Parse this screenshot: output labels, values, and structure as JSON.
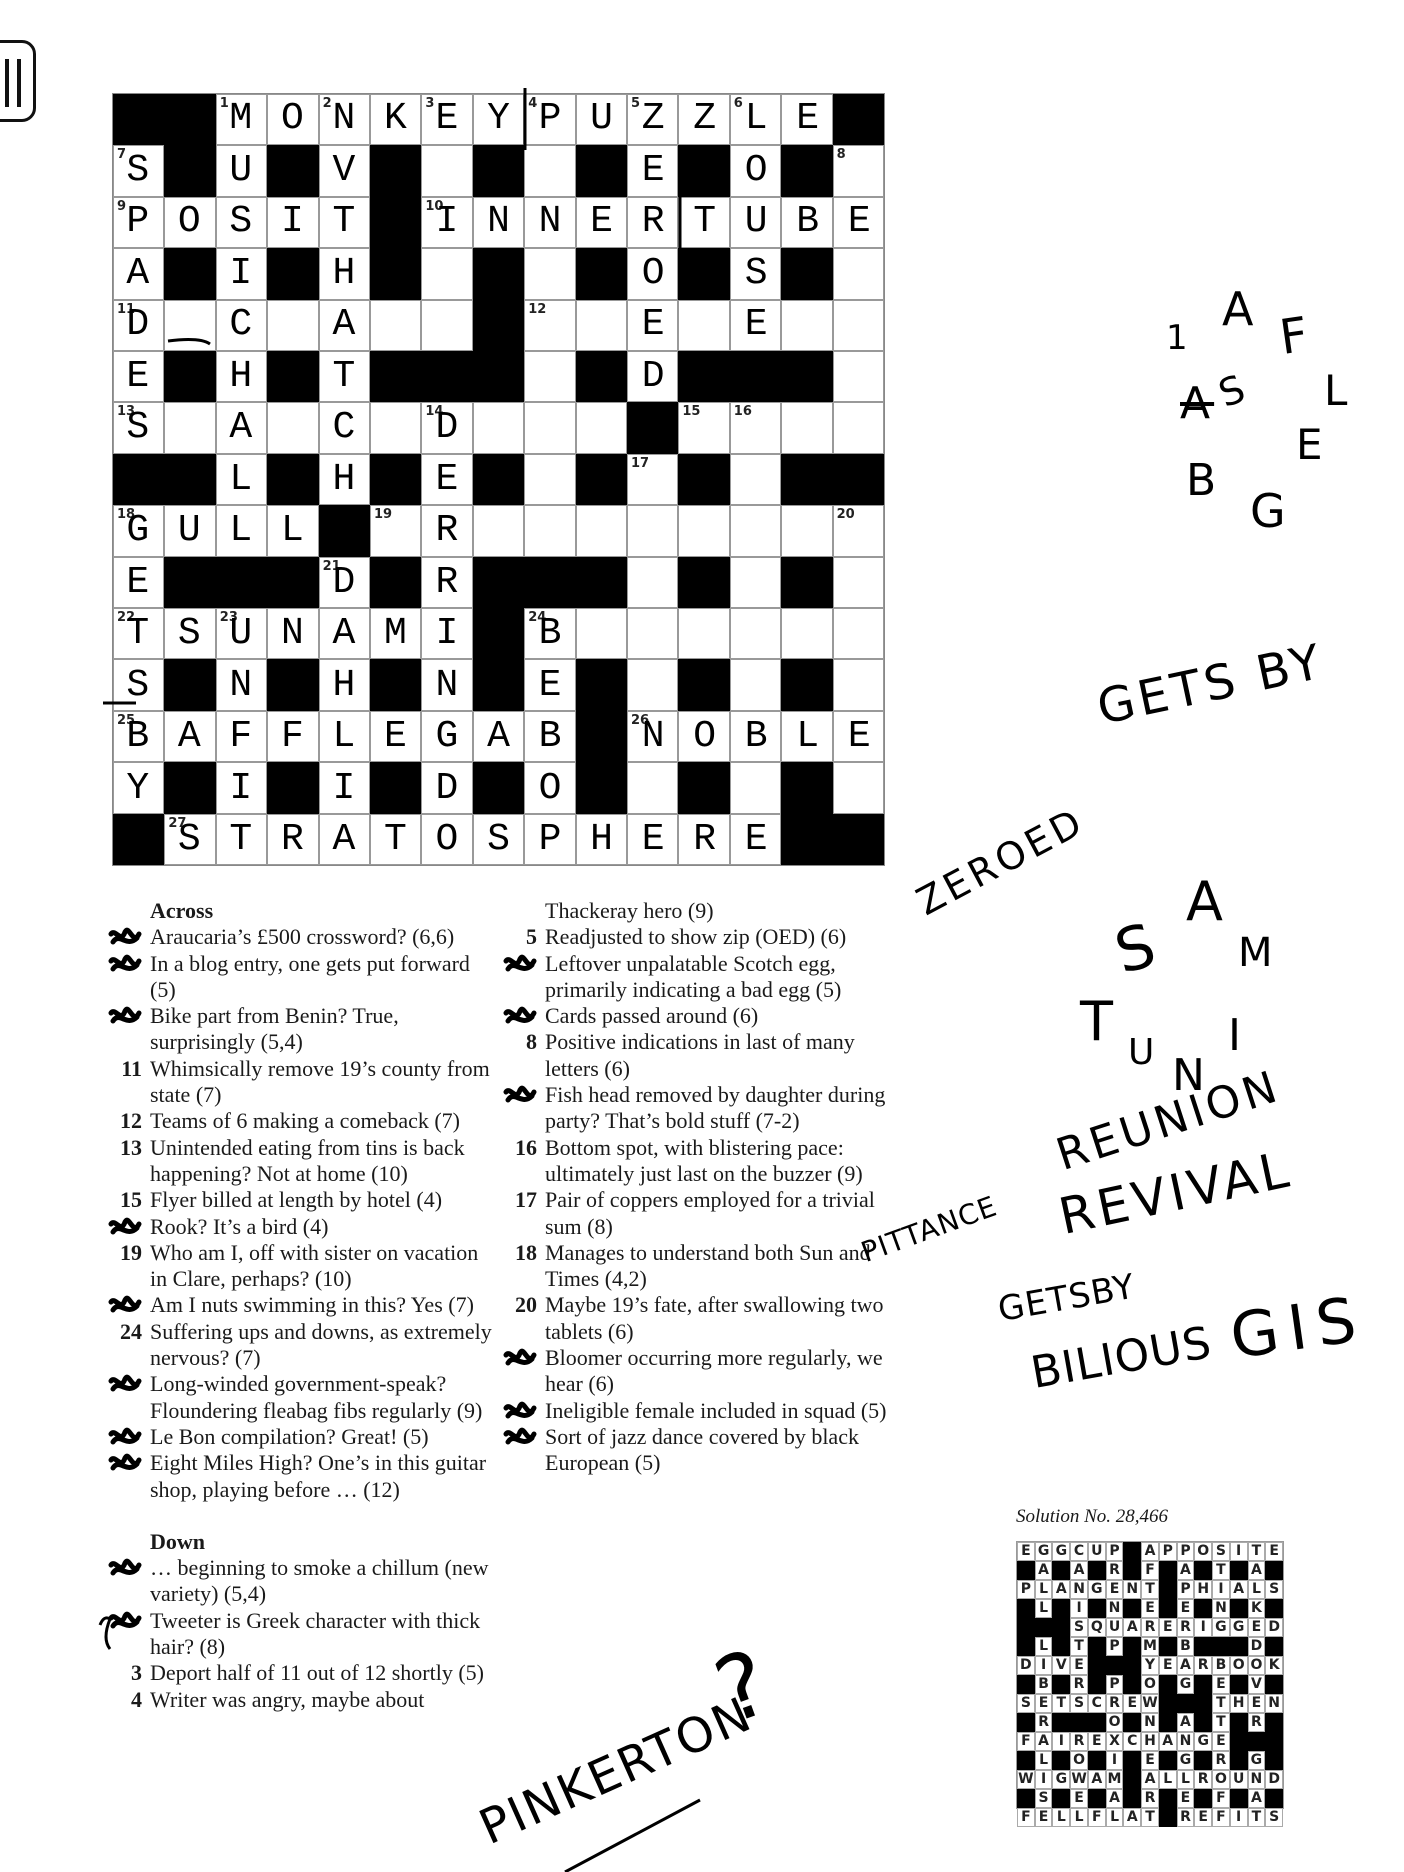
{
  "sidebar_toggle": {
    "icon": "sidebar-toggle-icon"
  },
  "puzzle": {
    "pattern": [
      "##............#",
      ".#.#.#.#.#.#.#.",
      ".....#.........",
      ".#.#.#.#.#.#.#.",
      ".......#.......",
      ".#.#.###.#.###.",
      "..........#....",
      "##.#.#.#.#.#.##",
      "....#..........",
      ".###.#.###.#.#.",
      ".......#.......",
      ".#.#.#.#.#.#.#.",
      ".........#.....",
      ".#.#.#.#.#.#.#.",
      "#............##"
    ],
    "entries": [
      "  MONKEYPUZZLE ",
      "S U V     E O  ",
      "POSIT INNERTUBE",
      "A I H     O S  ",
      "D C A     E E  ",
      "E H T     D    ",
      "S A C D        ",
      "  L H E        ",
      "GULL  R        ",
      "E   D R        ",
      "TSUNAMI B      ",
      "S N H N E      ",
      "BAFFLEGAB NOBLE",
      "Y I I D O      ",
      " STRATOSPHERE  "
    ],
    "numbers": [
      {
        "row": 0,
        "col": 2,
        "n": "1"
      },
      {
        "row": 0,
        "col": 4,
        "n": "2"
      },
      {
        "row": 0,
        "col": 6,
        "n": "3"
      },
      {
        "row": 0,
        "col": 8,
        "n": "4"
      },
      {
        "row": 0,
        "col": 10,
        "n": "5"
      },
      {
        "row": 0,
        "col": 12,
        "n": "6"
      },
      {
        "row": 1,
        "col": 0,
        "n": "7"
      },
      {
        "row": 1,
        "col": 14,
        "n": "8"
      },
      {
        "row": 2,
        "col": 0,
        "n": "9"
      },
      {
        "row": 2,
        "col": 6,
        "n": "10"
      },
      {
        "row": 4,
        "col": 0,
        "n": "11"
      },
      {
        "row": 4,
        "col": 8,
        "n": "12"
      },
      {
        "row": 6,
        "col": 0,
        "n": "13"
      },
      {
        "row": 6,
        "col": 6,
        "n": "14"
      },
      {
        "row": 6,
        "col": 11,
        "n": "15"
      },
      {
        "row": 6,
        "col": 12,
        "n": "16"
      },
      {
        "row": 7,
        "col": 10,
        "n": "17"
      },
      {
        "row": 8,
        "col": 0,
        "n": "18"
      },
      {
        "row": 8,
        "col": 5,
        "n": "19"
      },
      {
        "row": 8,
        "col": 14,
        "n": "20"
      },
      {
        "row": 9,
        "col": 4,
        "n": "21"
      },
      {
        "row": 10,
        "col": 0,
        "n": "22"
      },
      {
        "row": 10,
        "col": 2,
        "n": "23"
      },
      {
        "row": 10,
        "col": 8,
        "n": "24"
      },
      {
        "row": 12,
        "col": 0,
        "n": "25"
      },
      {
        "row": 12,
        "col": 10,
        "n": "26"
      },
      {
        "row": 14,
        "col": 1,
        "n": "27"
      }
    ]
  },
  "clues": {
    "across_heading": "Across",
    "down_heading": "Down",
    "across": [
      {
        "n": "",
        "scribbled": true,
        "text": "Araucaria’s £500 crossword? (6,6)"
      },
      {
        "n": "",
        "scribbled": true,
        "text": "In a blog entry, one gets put forward (5)"
      },
      {
        "n": "",
        "scribbled": true,
        "text": "Bike part from Benin? True, surprisingly (5,4)"
      },
      {
        "n": "11",
        "text": "Whimsically remove 19’s county from state (7)"
      },
      {
        "n": "12",
        "text": "Teams of 6 making a comeback (7)"
      },
      {
        "n": "13",
        "text": "Unintended eating from tins is back happening? Not at home (10)"
      },
      {
        "n": "15",
        "text": "Flyer billed at length by hotel (4)"
      },
      {
        "n": "",
        "scribbled": true,
        "text": "Rook? It’s a bird (4)"
      },
      {
        "n": "19",
        "text": "Who am I, off with sister on vacation in Clare, perhaps? (10)"
      },
      {
        "n": "",
        "scribbled": true,
        "text": "Am I nuts swimming in this? Yes (7)"
      },
      {
        "n": "24",
        "text": "Suffering ups and downs, as extremely nervous? (7)"
      },
      {
        "n": "",
        "scribbled": true,
        "text": "Long-winded government-speak? Floundering fleabag fibs regularly (9)"
      },
      {
        "n": "",
        "scribbled": true,
        "text": "Le Bon compilation? Great! (5)"
      },
      {
        "n": "",
        "scribbled": true,
        "text": "Eight Miles High? One’s in this guitar shop, playing before … (12)"
      }
    ],
    "down_left": [
      {
        "n": "",
        "scribbled": true,
        "text": "… beginning to smoke a chillum (new variety) (5,4)"
      },
      {
        "n": "",
        "scribbled": true,
        "text": "Tweeter is Greek character with thick hair? (8)"
      },
      {
        "n": "3",
        "text": "Deport half of 11 out of 12 shortly (5)"
      },
      {
        "n": "4",
        "text": "Writer was angry, maybe about"
      }
    ],
    "down_right": [
      {
        "n": "",
        "text": "Thackeray hero (9)"
      },
      {
        "n": "5",
        "text": "Readjusted to show zip (OED) (6)"
      },
      {
        "n": "",
        "scribbled": true,
        "text": "Leftover unpalatable Scotch egg, primarily indicating a bad egg (5)"
      },
      {
        "n": "",
        "scribbled": true,
        "text": "Cards passed around (6)"
      },
      {
        "n": "8",
        "text": "Positive indications in last of many letters (6)"
      },
      {
        "n": "",
        "scribbled": true,
        "text": "Fish head removed by daughter during party? That’s bold stuff (7-2)"
      },
      {
        "n": "16",
        "text": "Bottom spot, with blistering pace: ultimately just last on the buzzer (9)"
      },
      {
        "n": "17",
        "text": "Pair of coppers employed for a trivial sum (8)"
      },
      {
        "n": "18",
        "text": "Manages to understand both Sun and Times (4,2)"
      },
      {
        "n": "20",
        "text": "Maybe 19’s fate, after swallowing two tablets (6)"
      },
      {
        "n": "",
        "scribbled": true,
        "text": "Bloomer occurring more regularly, we hear (6)"
      },
      {
        "n": "",
        "scribbled": true,
        "text": "Ineligible female included in squad (5)"
      },
      {
        "n": "",
        "scribbled": true,
        "text": "Sort of jazz dance covered by black European (5)"
      }
    ]
  },
  "notes": {
    "anagram_letters": [
      "1",
      "A",
      "F",
      "A",
      "S",
      "L",
      "B",
      "E",
      "G"
    ],
    "gets_by_1": "GETS BY",
    "zeroed": "ZEROED",
    "tsunami_letters": [
      "T",
      "S",
      "A",
      "M",
      "U",
      "N",
      "I"
    ],
    "reunion": "REUNION",
    "revival": "REVIVAL",
    "pittance": "PITTANCE",
    "gets_by_2": "GETSBY",
    "bilious": "BILIOUS",
    "gis": "GIS",
    "pinkerton": "PINKERTON",
    "question": "?"
  },
  "solution": {
    "title": "Solution No. 28,466",
    "rows": [
      "EGGCUP#APPOSITE",
      "#A#A#R#F#A#T#A#",
      "PLANGENT#PHIALS",
      "#L#I#N#E#E#N#K#",
      "###SQUARERIGGED",
      "#L#T#P#M#B###D#",
      "DIVE###YEARBOOK",
      "#B#R#P#O#G#E#V#",
      "SETSCREW###THEN",
      "#R###O#N#A#T#R#",
      "FAIREXCHANGE###",
      "#L#O#I#E#G#R#G#",
      "WIGWAM#ALLROUND",
      "#S#E#A#R#E#F#A#",
      "FELLFLAT#REFITS"
    ]
  }
}
